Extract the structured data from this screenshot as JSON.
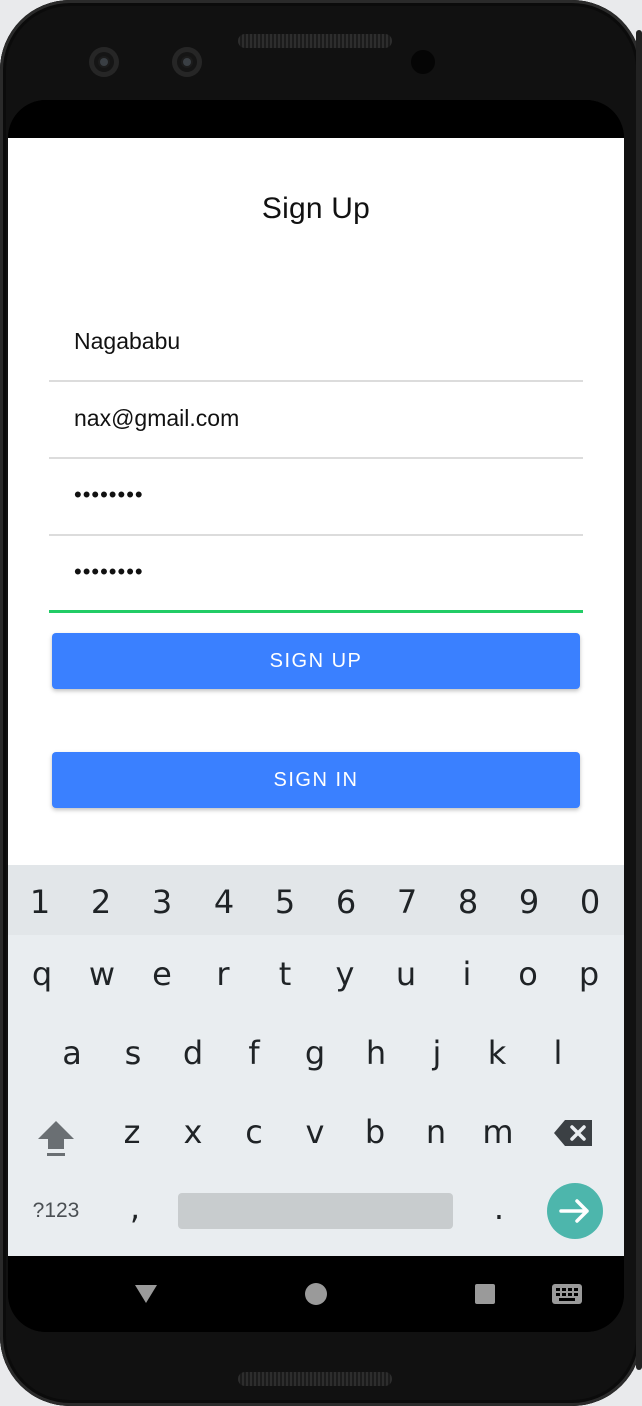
{
  "app": {
    "title": "Sign Up",
    "fields": {
      "name": "Nagababu",
      "email": "nax@gmail.com",
      "password": "........",
      "confirm_password": "........"
    },
    "signup_label": "SIGN UP",
    "signin_label": "SIGN IN"
  },
  "keyboard": {
    "numbers": [
      "1",
      "2",
      "3",
      "4",
      "5",
      "6",
      "7",
      "8",
      "9",
      "0"
    ],
    "row1": [
      "q",
      "w",
      "e",
      "r",
      "t",
      "y",
      "u",
      "i",
      "o",
      "p"
    ],
    "row2": [
      "a",
      "s",
      "d",
      "f",
      "g",
      "h",
      "j",
      "k",
      "l"
    ],
    "row3": [
      "z",
      "x",
      "c",
      "v",
      "b",
      "n",
      "m"
    ],
    "symbols_label": "?123",
    "comma": ",",
    "period": ".",
    "enter_color": "#4db6ac"
  },
  "colors": {
    "primary_button": "#3a80ff",
    "focus_underline": "#22cc66"
  }
}
